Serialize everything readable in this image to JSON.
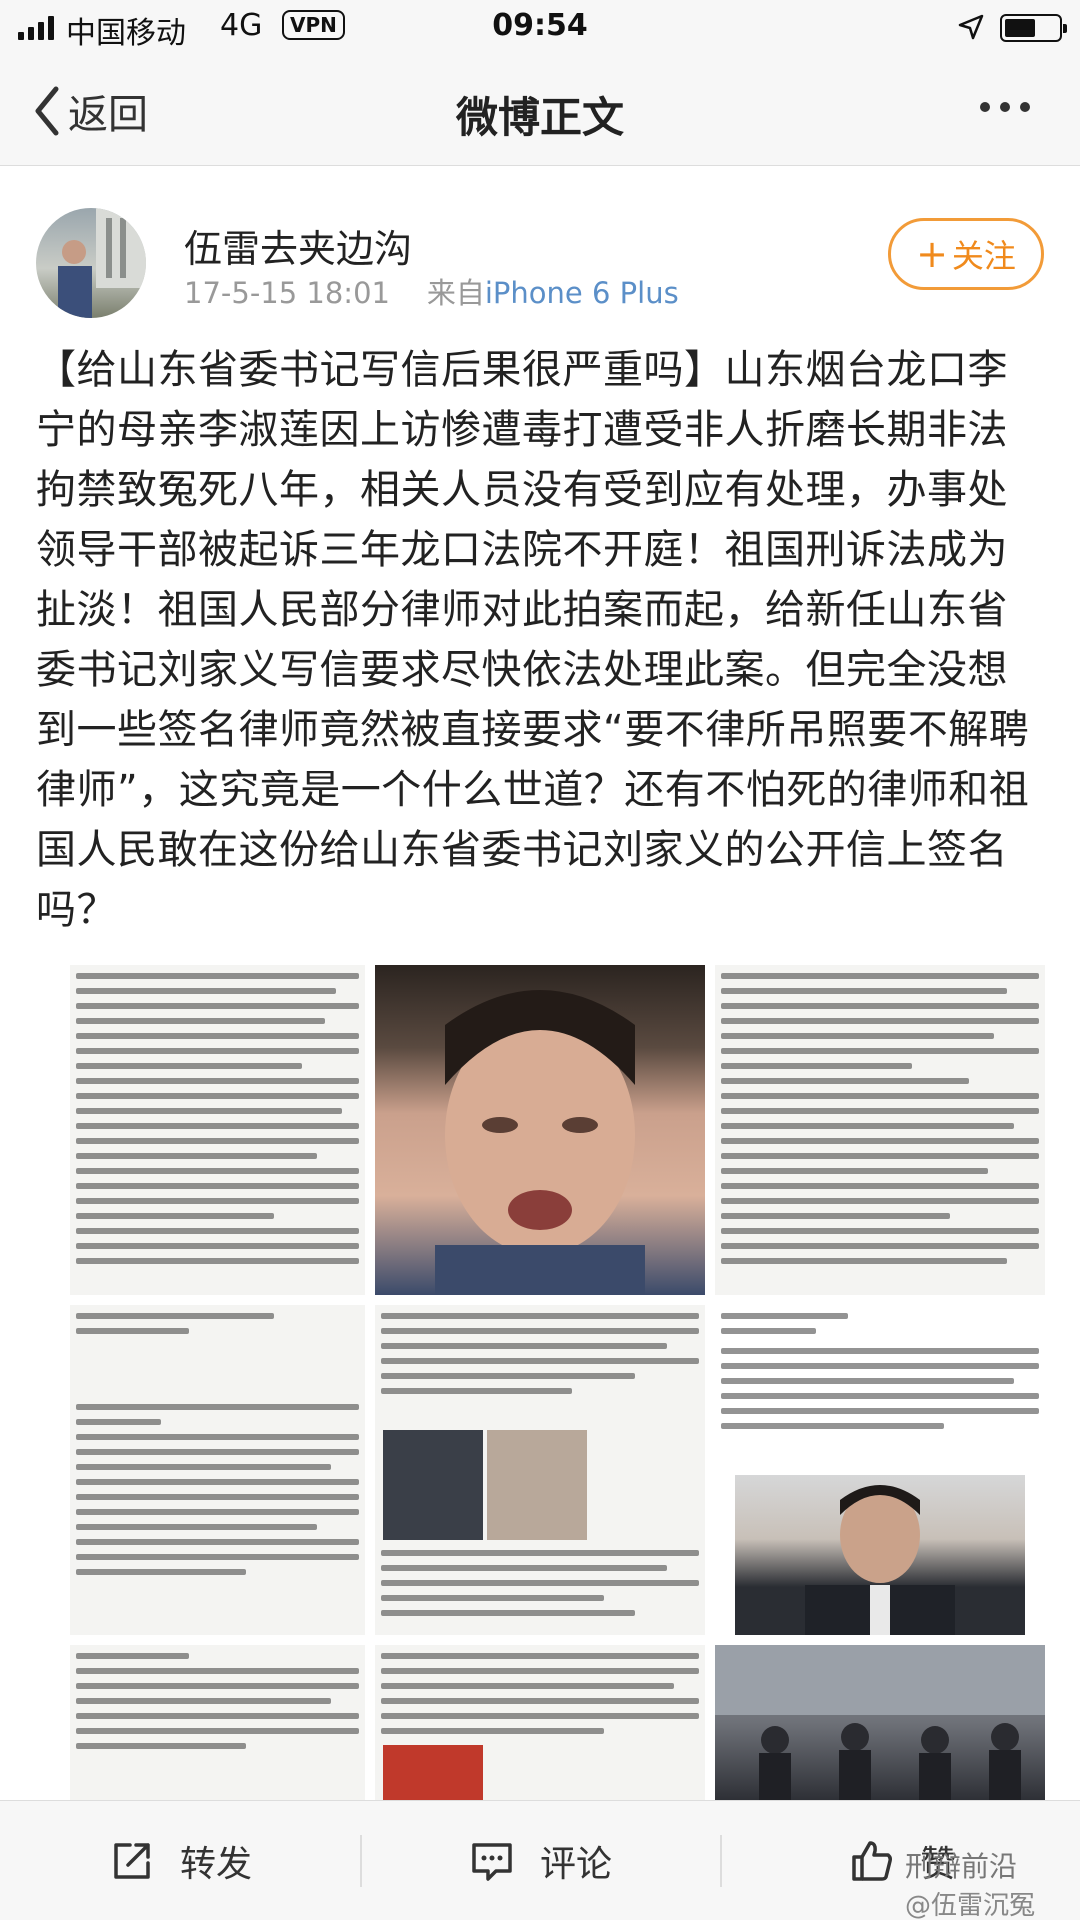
{
  "status_bar": {
    "carrier": "中国移动",
    "network": "4G",
    "vpn": "VPN",
    "time": "09:54"
  },
  "nav": {
    "back_label": "返回",
    "title": "微博正文"
  },
  "post": {
    "author": "伍雷去夹边沟",
    "timestamp": "17-5-15 18:01",
    "source_prefix": "来自",
    "source": "iPhone 6 Plus",
    "follow_label": "关注",
    "text": "【给山东省委书记写信后果很严重吗】山东烟台龙口李宁的母亲李淑莲因上访惨遭毒打遭受非人折磨长期非法拘禁致冤死八年，相关人员没有受到应有处理，办事处领导干部被起诉三年龙口法院不开庭！祖国刑诉法成为扯淡！祖国人民部分律师对此拍案而起，给新任山东省委书记刘家义写信要求尽快依法处理此案。但完全没想到一些签名律师竟然被直接要求“要不律所吊照要不解聘律师”，这究竟是一个什么世道？还有不怕死的律师和祖国人民敢在这份给山东省委书记刘家义的公开信上签名吗？"
  },
  "toolbar": {
    "repost_label": "转发",
    "comment_label": "评论",
    "like_label": "赞"
  },
  "watermark": {
    "line1": "刑辩前沿",
    "line2": "@伍雷沉冤"
  }
}
